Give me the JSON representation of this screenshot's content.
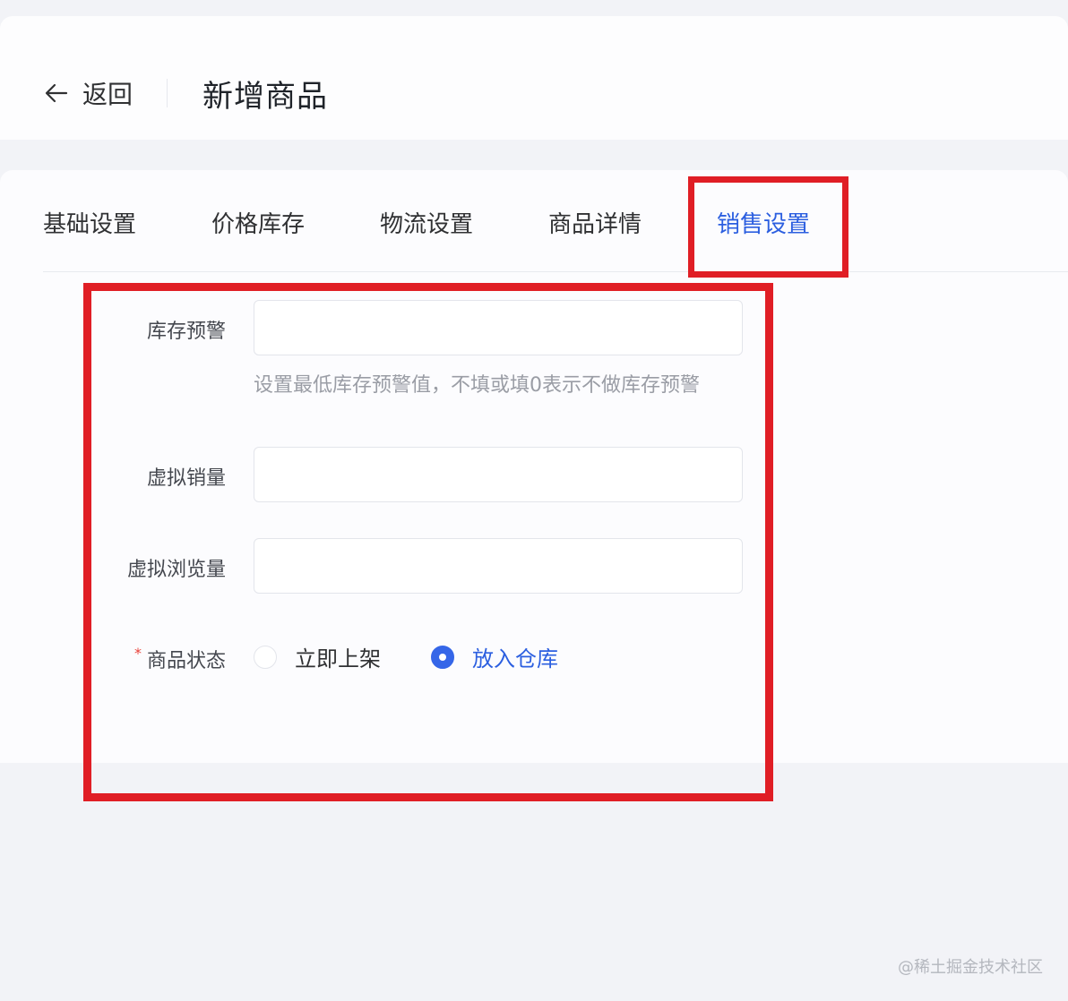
{
  "header": {
    "back_label": "返回",
    "title": "新增商品"
  },
  "tabs": [
    {
      "label": "基础设置",
      "active": false
    },
    {
      "label": "价格库存",
      "active": false
    },
    {
      "label": "物流设置",
      "active": false
    },
    {
      "label": "商品详情",
      "active": false
    },
    {
      "label": "销售设置",
      "active": true
    }
  ],
  "form": {
    "stock_warning": {
      "label": "库存预警",
      "value": "",
      "hint": "设置最低库存预警值，不填或填0表示不做库存预警"
    },
    "virtual_sales": {
      "label": "虚拟销量",
      "value": ""
    },
    "virtual_views": {
      "label": "虚拟浏览量",
      "value": ""
    },
    "status": {
      "required_mark": "*",
      "label": "商品状态",
      "options": [
        {
          "label": "立即上架",
          "checked": false
        },
        {
          "label": "放入仓库",
          "checked": true
        }
      ]
    }
  },
  "icons": {
    "back": "arrow-left-icon"
  },
  "colors": {
    "accent": "#2c5fe0",
    "highlight": "#e01e25",
    "required": "#e9423a"
  },
  "watermark": "@稀土掘金技术社区"
}
